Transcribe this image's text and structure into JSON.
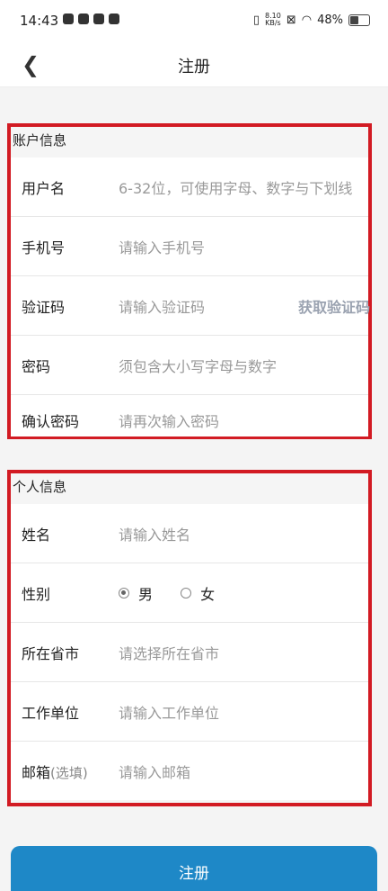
{
  "status": {
    "time": "14:43",
    "net_speed_value": "8.10",
    "net_speed_unit": "KB/s",
    "battery": "48%"
  },
  "nav": {
    "title": "注册"
  },
  "account": {
    "title": "账户信息",
    "username_label": "用户名",
    "username_placeholder": "6-32位，可使用字母、数字与下划线",
    "phone_label": "手机号",
    "phone_placeholder": "请输入手机号",
    "code_label": "验证码",
    "code_placeholder": "请输入验证码",
    "get_code": "获取验证码",
    "password_label": "密码",
    "password_placeholder": "须包含大小写字母与数字",
    "confirm_label": "确认密码",
    "confirm_placeholder": "请再次输入密码"
  },
  "personal": {
    "title": "个人信息",
    "name_label": "姓名",
    "name_placeholder": "请输入姓名",
    "gender_label": "性别",
    "gender_male": "男",
    "gender_female": "女",
    "gender_selected": "男",
    "region_label": "所在省市",
    "region_placeholder": "请选择所在省市",
    "work_label": "工作单位",
    "work_placeholder": "请输入工作单位",
    "email_label": "邮箱",
    "email_optional": "(选填)",
    "email_placeholder": "请输入邮箱"
  },
  "colors": {
    "highlight_border": "#d21b23",
    "button": "#1e88c7"
  }
}
